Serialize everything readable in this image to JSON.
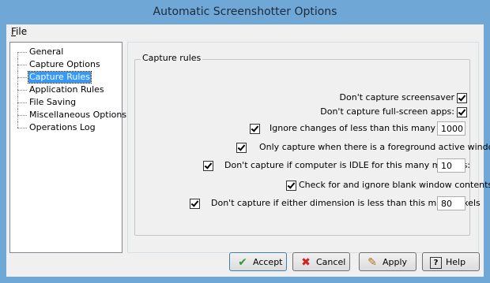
{
  "window": {
    "title": "Automatic Screenshotter Options"
  },
  "menu": {
    "file_label": "File",
    "file_mnemonic": "F",
    "file_rest": "ile"
  },
  "tree": {
    "items": [
      {
        "label": "General"
      },
      {
        "label": "Capture Options"
      },
      {
        "label": "Capture Rules",
        "selected": true
      },
      {
        "label": "Application Rules"
      },
      {
        "label": "File Saving"
      },
      {
        "label": "Miscellaneous Options"
      },
      {
        "label": "Operations Log"
      }
    ]
  },
  "capture_rules": {
    "group_title": "Capture rules",
    "screensaver": {
      "label": "Don't capture screensaver",
      "checked": true
    },
    "fullscreen": {
      "label": "Don't capture full-screen apps:",
      "checked": true
    },
    "ignore_changes": {
      "label": "Ignore changes of less than this many pixels:",
      "checked": true,
      "value": "1000"
    },
    "foreground": {
      "label": "Only capture when there is a foreground active window",
      "checked": true
    },
    "idle": {
      "label": "Don't capture if computer is IDLE for this many minutes:",
      "checked": true,
      "value": "10"
    },
    "blank": {
      "label": "Check for and ignore blank window contents",
      "checked": true
    },
    "dimension": {
      "label": "Don't capture if either dimension is less than this many pixels",
      "checked": true,
      "value": "80"
    }
  },
  "buttons": {
    "accept": "Accept",
    "cancel": "Cancel",
    "apply": "Apply",
    "help": "Help"
  },
  "icons": {
    "accept": "check-icon",
    "cancel": "x-icon",
    "apply": "pencil-icon",
    "help": "question-icon"
  }
}
